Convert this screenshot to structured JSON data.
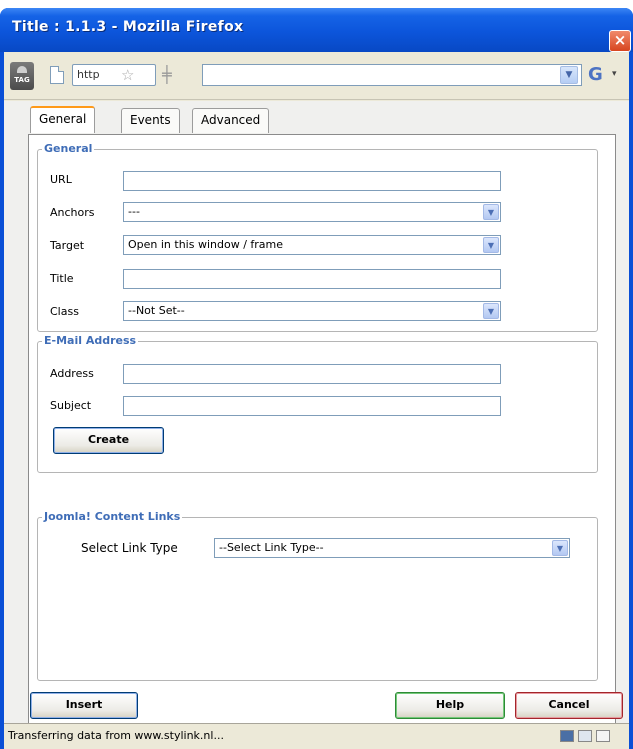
{
  "window": {
    "title": "Title : 1.1.3 - Mozilla Firefox",
    "close_glyph": "×"
  },
  "toolbar": {
    "tag_icon_label": "TAG",
    "address_text": "http",
    "star_icon": "☆",
    "grip_icon": "╪",
    "search_engine_icon": "G",
    "url_value": ""
  },
  "tabs": [
    {
      "label": "General",
      "active": true
    },
    {
      "label": "Events",
      "active": false
    },
    {
      "label": "Advanced",
      "active": false
    }
  ],
  "general": {
    "legend": "General",
    "url_label": "URL",
    "url_value": "",
    "anchors_label": "Anchors",
    "anchors_value": "---",
    "target_label": "Target",
    "target_value": "Open in this window / frame",
    "title_label": "Title",
    "title_value": "",
    "class_label": "Class",
    "class_value": "--Not Set--"
  },
  "email": {
    "legend": "E-Mail Address",
    "address_label": "Address",
    "address_value": "",
    "subject_label": "Subject",
    "subject_value": "",
    "create_label": "Create"
  },
  "joomla": {
    "legend": "Joomla! Content Links",
    "link_type_label": "Select Link Type",
    "link_type_value": "--Select Link Type--"
  },
  "buttons": {
    "insert": "Insert",
    "help": "Help",
    "cancel": "Cancel"
  },
  "status": {
    "text": "Transferring data from www.stylink.nl..."
  },
  "colors": {
    "titlebar": "#0c55db",
    "legend_text": "#3f6db7",
    "active_tab_accent": "#ff9a1a"
  }
}
